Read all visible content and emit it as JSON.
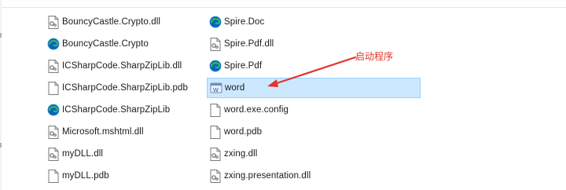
{
  "window": {
    "title": ""
  },
  "files": {
    "col0": [
      {
        "name": "BouncyCastle.Crypto.dll",
        "icon": "file-dll-icon"
      },
      {
        "name": "BouncyCastle.Crypto",
        "icon": "edge-html-icon"
      },
      {
        "name": "ICSharpCode.SharpZipLib.dll",
        "icon": "file-dll-icon"
      },
      {
        "name": "ICSharpCode.SharpZipLib.pdb",
        "icon": "file-blank-icon"
      },
      {
        "name": "ICSharpCode.SharpZipLib",
        "icon": "edge-html-icon"
      },
      {
        "name": "Microsoft.mshtml.dll",
        "icon": "file-dll-icon"
      },
      {
        "name": "myDLL.dll",
        "icon": "file-dll-icon"
      },
      {
        "name": "myDLL.pdb",
        "icon": "file-blank-icon"
      }
    ],
    "col1": [
      {
        "name": "Spire.Doc",
        "icon": "edge-html-icon"
      },
      {
        "name": "Spire.Pdf.dll",
        "icon": "file-dll-icon"
      },
      {
        "name": "Spire.Pdf",
        "icon": "edge-html-icon"
      },
      {
        "name": "word",
        "icon": "app-exe-icon",
        "selected": true
      },
      {
        "name": "word.exe.config",
        "icon": "file-blank-icon"
      },
      {
        "name": "word.pdb",
        "icon": "file-blank-icon"
      },
      {
        "name": "zxing.dll",
        "icon": "file-dll-icon"
      },
      {
        "name": "zxing.presentation.dll",
        "icon": "file-dll-icon"
      }
    ]
  },
  "annotation": {
    "text": "启动程序",
    "color": "#e0352b"
  },
  "colors": {
    "selection_bg": "#cce8ff",
    "selection_border": "#99d1ff",
    "edge_blue": "#0c63b8",
    "edge_green": "#31b46a"
  }
}
